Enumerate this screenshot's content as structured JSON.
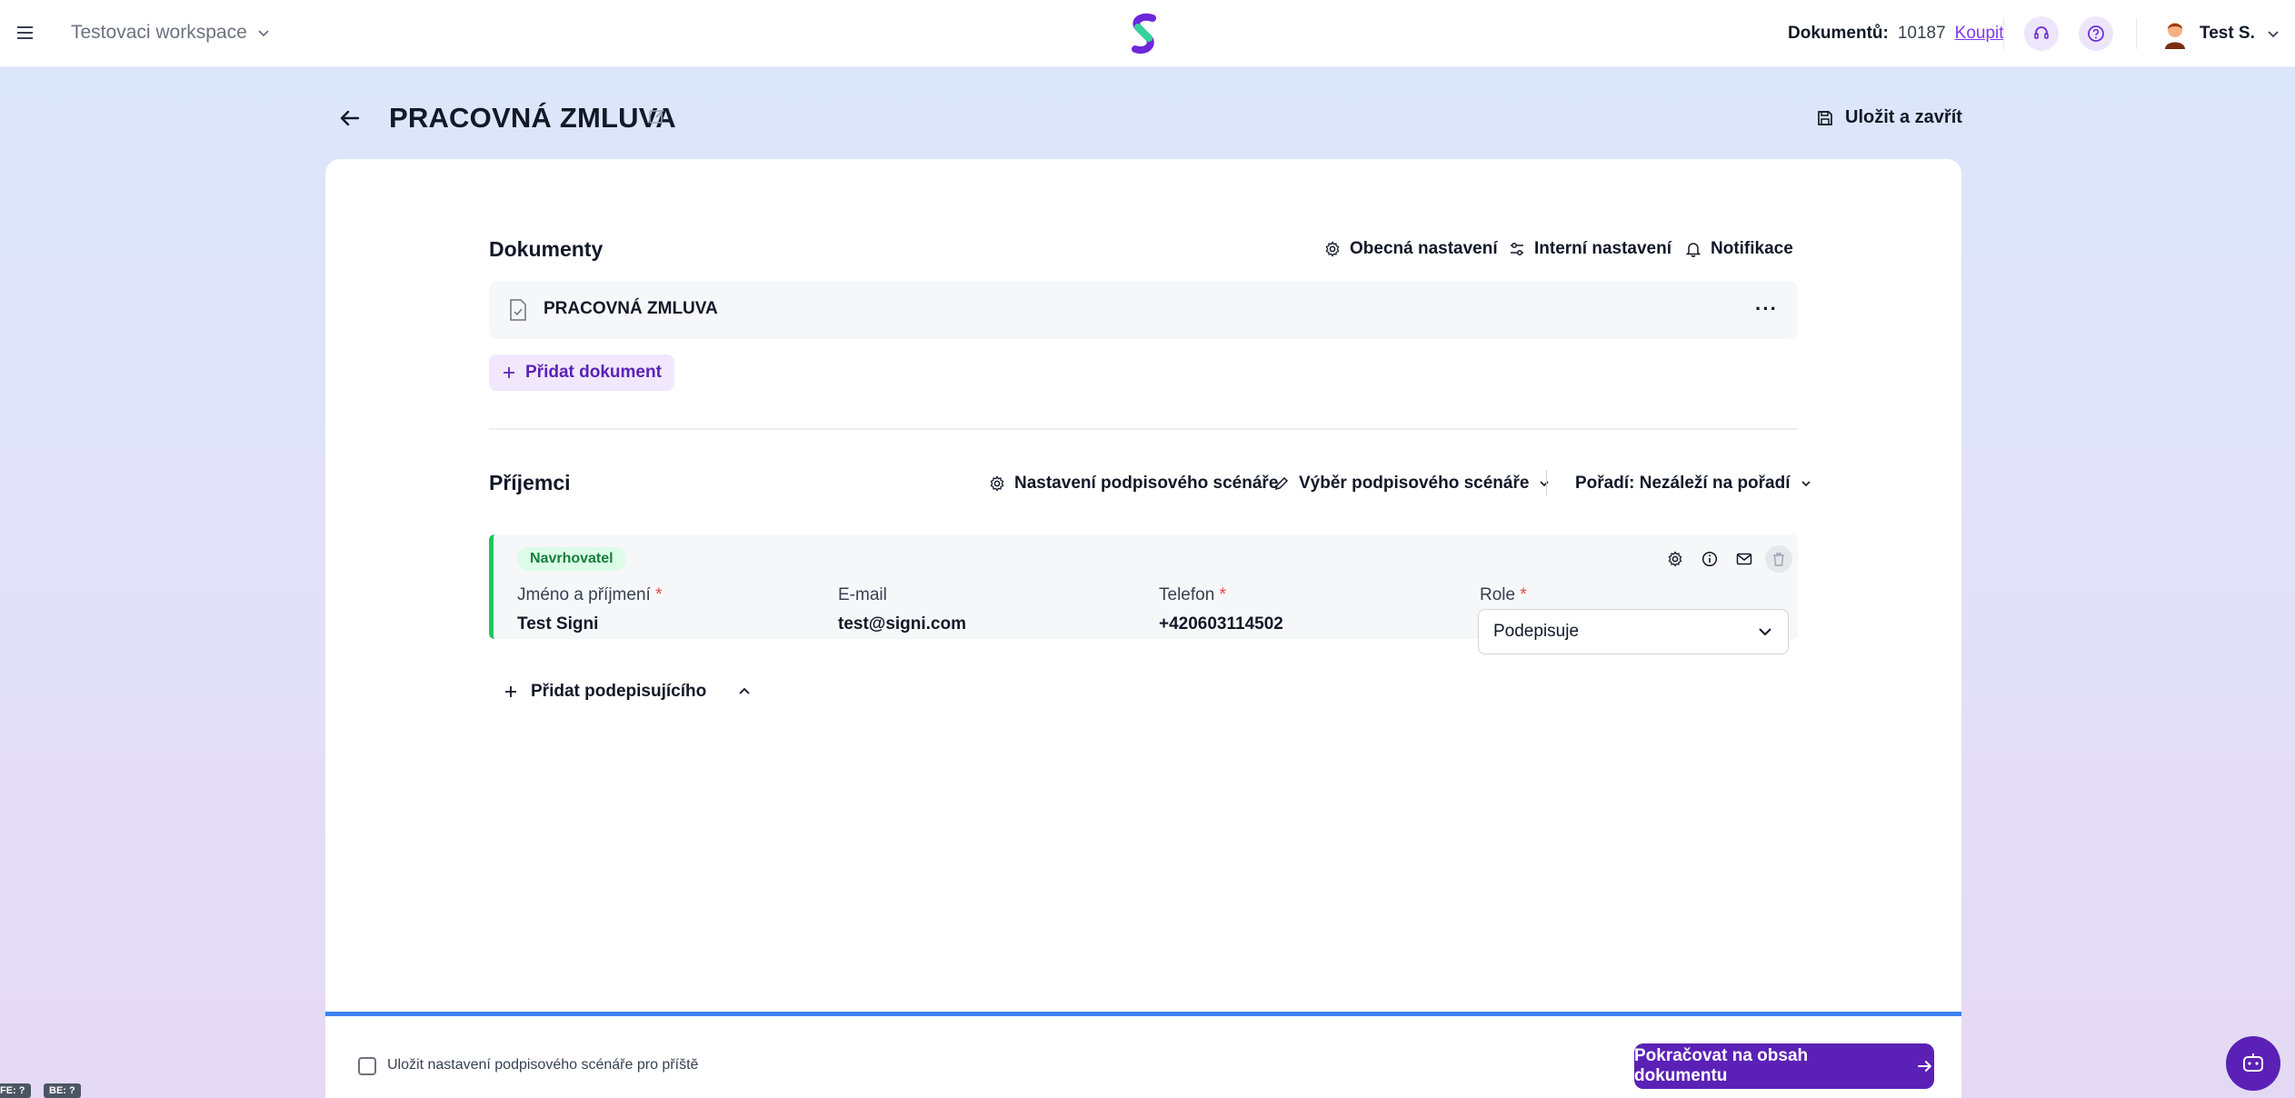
{
  "topbar": {
    "workspace": "Testovaci workspace",
    "documents_label": "Dokumentů:",
    "documents_count": "10187",
    "buy_label": "Koupit",
    "user_name": "Test S."
  },
  "header": {
    "title": "PRACOVNÁ ZMLUVA",
    "save_close_label": "Uložit a zavřít"
  },
  "documents": {
    "title": "Dokumenty",
    "general_settings": "Obecná nastavení",
    "internal_settings": "Interní nastavení",
    "notifications": "Notifikace",
    "items": [
      {
        "name": "PRACOVNÁ ZMLUVA"
      }
    ],
    "add_label": "Přidat dokument"
  },
  "recipients": {
    "title": "Příjemci",
    "scenario_settings": "Nastavení podpisového scénáře",
    "scenario_choice": "Výběr podpisového scénáře",
    "order": "Pořadí: Nezáleží na pořadí",
    "items": [
      {
        "badge": "Navrhovatel",
        "name_label": "Jméno a příjmení",
        "name": "Test Signi",
        "email_label": "E-mail",
        "email": "test@signi.com",
        "phone_label": "Telefon",
        "phone": "+420603114502",
        "role_label": "Role",
        "role": "Podepisuje"
      }
    ],
    "required_mark": "*",
    "add_signer_label": "Přidat podepisujícího"
  },
  "footer": {
    "save_scenario_label": "Uložit nastavení podpisového scénáře pro příště",
    "continue_label": "Pokračovat na obsah dokumentu"
  },
  "debug": {
    "fe": "FE: ?",
    "be": "BE: ?"
  },
  "colors": {
    "primary": "#5b21b6",
    "accent_green": "#22c55e",
    "progress_blue": "#3b82f6"
  }
}
